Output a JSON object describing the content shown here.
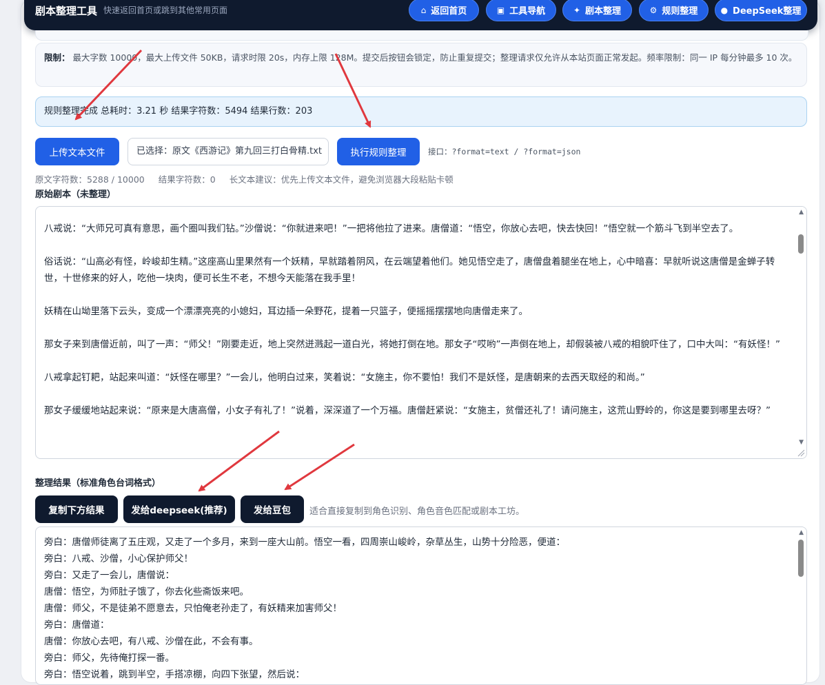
{
  "header": {
    "brand": "剧本整理工具",
    "subtitle": "快速返回首页或跳到其他常用页面",
    "nav": [
      {
        "label": "返回首页",
        "icon": "home-icon"
      },
      {
        "label": "工具导航",
        "icon": "grid-icon"
      },
      {
        "label": "剧本整理",
        "icon": "sparkle-icon"
      },
      {
        "label": "规则整理",
        "icon": "gear-icon"
      },
      {
        "label": "DeepSeek整理",
        "icon": "dot-icon"
      }
    ]
  },
  "limits": {
    "label": "限制：",
    "text": "最大字数 10000，最大上传文件 50KB，请求时限 20s，内存上限 128M。提交后按钮会锁定，防止重复提交；整理请求仅允许从本站页面正常发起。频率限制：同一 IP 每分钟最多 10 次。"
  },
  "status": {
    "text": "规则整理完成 总耗时：3.21 秒 结果字符数：5494 结果行数：203"
  },
  "upload": {
    "upload_button": "上传文本文件",
    "selected_file": "已选择：原文《西游记》第九回三打白骨精.txt",
    "run_button": "执行规则整理",
    "api_label": "接口：?format=text / ?format=json"
  },
  "counts": {
    "source": "原文字符数：5288 / 10000",
    "result": "结果字符数：0",
    "advice": "长文本建议：优先上传文本文件，避免浏览器大段粘贴卡顿"
  },
  "raw": {
    "label": "原始剧本（未整理）",
    "paragraphs": [
      "八戒说：“大师兄可真有意思，画个圈叫我们钻。”沙僧说：“你就进来吧！”一把将他拉了进来。唐僧道：“悟空，你放心去吧，快去快回！”悟空就一个筋斗飞到半空去了。",
      "俗话说：“山高必有怪，岭峻却生精。”这座高山里果然有一个妖精，早就踏着阴风，在云端望着他们。她见悟空走了，唐僧盘着腿坐在地上，心中暗喜：早就听说这唐僧是金蝉子转世，十世修来的好人，吃他一块肉，便可长生不老，不想今天能落在我手里！",
      "妖精在山坳里落下云头，变成一个漂漂亮亮的小媳妇，耳边插一朵野花，提着一只篮子，便摇摇摆摆地向唐僧走来了。",
      "那女子来到唐僧近前，叫了一声：“师父！”刚要走近，地上突然迸溅起一道白光，将她打倒在地。那女子“哎哟”一声倒在地上，却假装被八戒的相貌吓住了，口中大叫：“有妖怪！”",
      "八戒拿起钉耙，站起来叫道：“妖怪在哪里？”一会儿，他明白过来，笑着说：“女施主，你不要怕！我们不是妖怪，是唐朝来的去西天取经的和尚。”",
      "那女子缓缓地站起来说：“原来是大唐高僧，小女子有礼了！”说着，深深道了一个万福。唐僧赶紧说：“女施主，贫僧还礼了！请问施主，这荒山野岭的，你这是要到哪里去呀？”"
    ]
  },
  "result": {
    "label": "整理结果（标准角色台词格式）",
    "copy_button": "复制下方结果",
    "deepseek_button": "发给deepseek(推荐)",
    "doubao_button": "发给豆包",
    "hint": "适合直接复制到角色识别、角色音色匹配或剧本工坊。",
    "lines": [
      "旁白：唐僧师徒离了五庄观，又走了一个多月，来到一座大山前。悟空一看，四周崇山峻岭，杂草丛生，山势十分险恶，便道：",
      "旁白：八戒、沙僧，小心保护师父！",
      "旁白：又走了一会儿，唐僧说：",
      "唐僧：悟空，为师肚子饿了，你去化些斋饭来吧。",
      "唐僧：师父，不是徒弟不愿意去，只怕俺老孙走了，有妖精来加害师父！",
      "旁白：唐僧道：",
      "唐僧：你放心去吧，有八戒、沙僧在此，不会有事。",
      "旁白：师父，先待俺打探一番。",
      "旁白：悟空说着，跳到半空，手搭凉棚，向四下张望，然后说："
    ]
  },
  "colors": {
    "nav_blue": "#2160e6",
    "header_dark": "#0f1a2e",
    "status_bg": "#e8f3fd",
    "annotation_arrow": "#e0383e"
  }
}
